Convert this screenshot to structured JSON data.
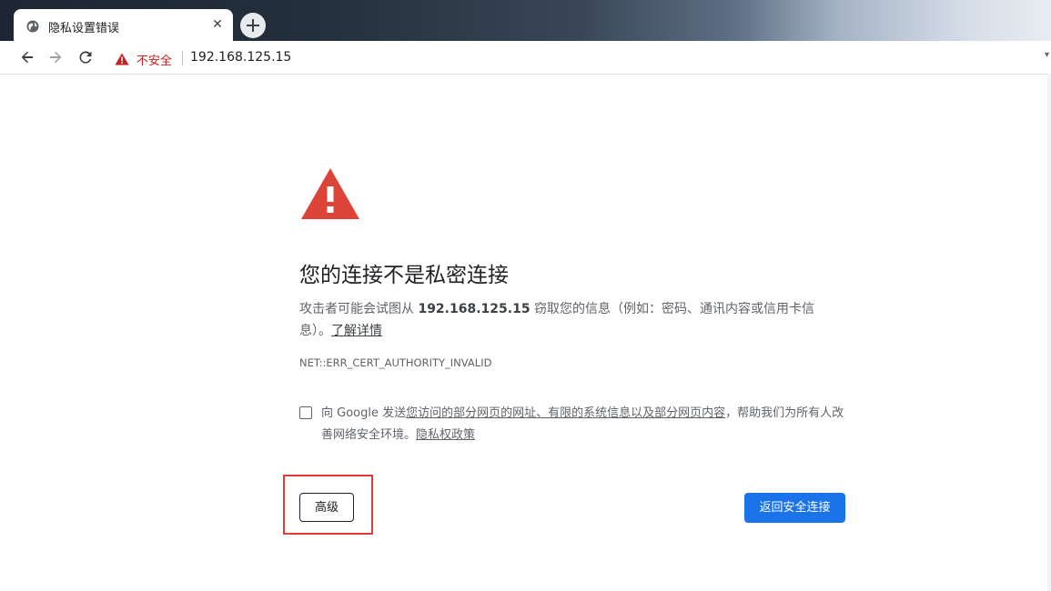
{
  "tab": {
    "title": "隐私设置错误",
    "favicon": "globe-icon",
    "close_symbol": "✕"
  },
  "toolbar": {
    "security_label": "不安全",
    "url": "192.168.125.15",
    "warning_color": "#c5221f"
  },
  "page": {
    "heading": "您的连接不是私密连接",
    "explain_prefix": "攻击者可能会试图从 ",
    "explain_host": "192.168.125.15",
    "explain_suffix": " 窃取您的信息（例如：密码、通讯内容或信用卡信息）。",
    "learn_more": "了解详情",
    "error_code": "NET::ERR_CERT_AUTHORITY_INVALID",
    "optin_prefix": "向 Google 发送",
    "optin_link": "您访问的部分网页的网址、有限的系统信息以及部分网页内容",
    "optin_suffix": "，帮助我们为所有人改善网络安全环境。",
    "privacy_link": "隐私权政策",
    "optin_checked": false,
    "advanced_label": "高级",
    "back_label": "返回安全连接",
    "accent_color": "#1a73e8",
    "alert_color": "#db4437",
    "highlight_color": "#e23b3b"
  }
}
